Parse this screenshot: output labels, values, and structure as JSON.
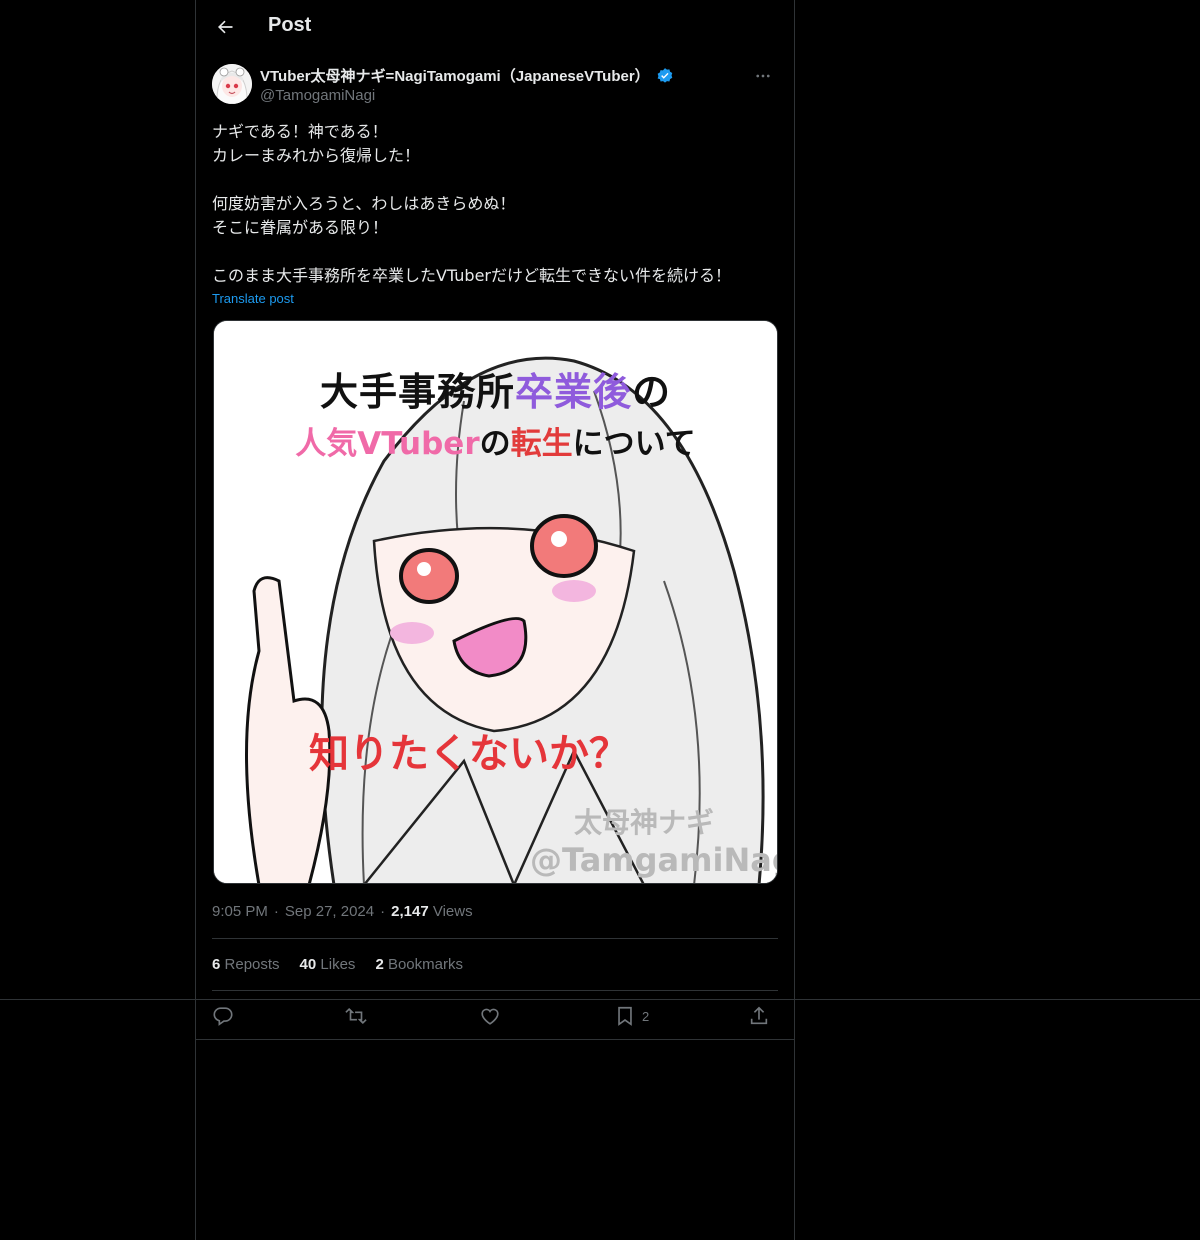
{
  "header": {
    "title": "Post"
  },
  "author": {
    "display_name": "VTuber太母神ナギ=NagiTamogami（JapaneseVTuber）",
    "handle": "@TamogamiNagi",
    "verified": true
  },
  "post": {
    "lines": [
      "ナギである！神である！",
      "カレーまみれから復帰した！",
      "",
      "何度妨害が入ろうと、わしはあきらめぬ！",
      "そこに眷属がある限り！",
      "",
      "このまま大手事務所を卒業したVTuberだけど転生できない件を続ける！"
    ],
    "translate_label": "Translate post"
  },
  "media_image": {
    "line1_black": "大手事務所",
    "line1_purple": "卒業後",
    "line1_end": "の",
    "line2_pink": "人気VTuber",
    "line2_mid": "の",
    "line2_red": "転生",
    "line2_end": "について",
    "line3": "知りたくないか？",
    "watermark_name": "太母神ナギ",
    "watermark_handle": "@TamgamiNagi"
  },
  "meta": {
    "time": "9:05 PM",
    "date": "Sep 27, 2024",
    "views_count": "2,147",
    "views_label": "Views"
  },
  "stats": {
    "reposts_count": "6",
    "reposts_label": "Reposts",
    "likes_count": "40",
    "likes_label": "Likes",
    "bookmarks_count": "2",
    "bookmarks_label": "Bookmarks"
  },
  "actions": {
    "bookmark_count": "2",
    "icons": [
      "reply-icon",
      "repost-icon",
      "like-icon",
      "bookmark-icon",
      "share-icon"
    ]
  },
  "colors": {
    "background": "#000000",
    "text": "#e7e9ea",
    "secondary": "#71767b",
    "link": "#1d9bf0",
    "border": "#2f3336",
    "verified": "#1d9bf0"
  }
}
